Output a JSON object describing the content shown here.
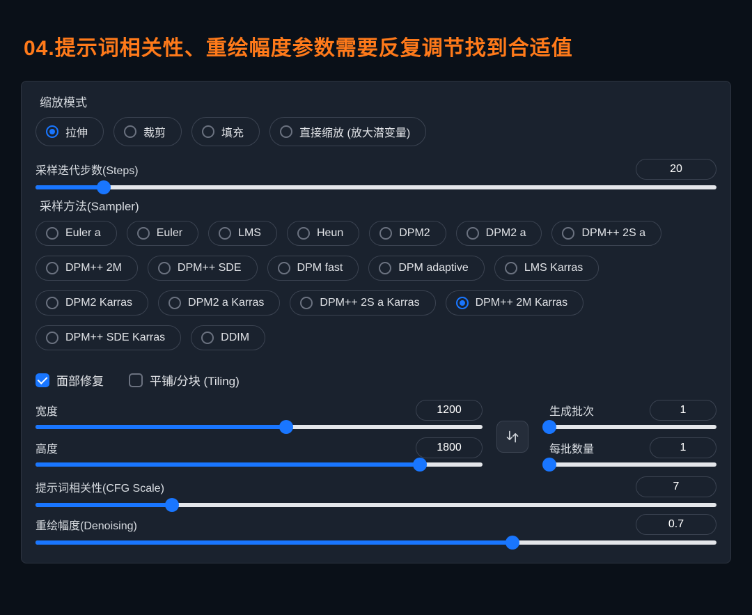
{
  "title": "04.提示词相关性、重绘幅度参数需要反复调节找到合适值",
  "scale_mode": {
    "legend": "缩放模式",
    "selected": 0,
    "options": [
      "拉伸",
      "裁剪",
      "填充",
      "直接缩放 (放大潜变量)"
    ]
  },
  "steps": {
    "label": "采样迭代步数(Steps)",
    "value": 20,
    "min": 1,
    "max": 150,
    "percent": 10
  },
  "sampler": {
    "legend": "采样方法(Sampler)",
    "selected": "DPM++ 2M Karras",
    "options": [
      "Euler a",
      "Euler",
      "LMS",
      "Heun",
      "DPM2",
      "DPM2 a",
      "DPM++ 2S a",
      "DPM++ 2M",
      "DPM++ SDE",
      "DPM fast",
      "DPM adaptive",
      "LMS Karras",
      "DPM2 Karras",
      "DPM2 a Karras",
      "DPM++ 2S a Karras",
      "DPM++ 2M Karras",
      "DPM++ SDE Karras",
      "DDIM"
    ]
  },
  "checks": {
    "face_restore": {
      "label": "面部修复",
      "checked": true
    },
    "tiling": {
      "label": "平铺/分块 (Tiling)",
      "checked": false
    }
  },
  "width": {
    "label": "宽度",
    "value": 1200,
    "percent": 56
  },
  "height": {
    "label": "高度",
    "value": 1800,
    "percent": 86
  },
  "batch_count": {
    "label": "生成批次",
    "value": 1,
    "percent": 0
  },
  "batch_size": {
    "label": "每批数量",
    "value": 1,
    "percent": 0
  },
  "cfg": {
    "label": "提示词相关性(CFG Scale)",
    "value": 7,
    "percent": 20
  },
  "denoise": {
    "label": "重绘幅度(Denoising)",
    "value": 0.7,
    "percent": 70
  },
  "icons": {
    "swap": "swap-vertical-icon"
  }
}
